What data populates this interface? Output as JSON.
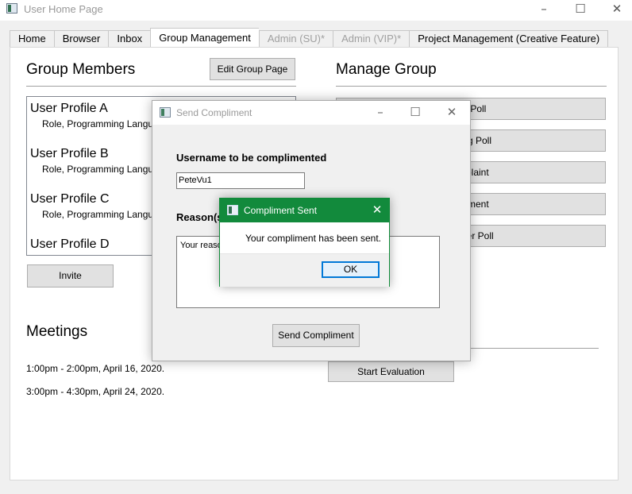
{
  "window": {
    "title": "User Home Page",
    "controls": {
      "minimize": "–",
      "maximize": "☐",
      "close": "✕"
    }
  },
  "tabs": [
    {
      "label": "Home",
      "state": "normal"
    },
    {
      "label": "Browser",
      "state": "normal"
    },
    {
      "label": "Inbox",
      "state": "normal"
    },
    {
      "label": "Group Management",
      "state": "active"
    },
    {
      "label": "Admin (SU)*",
      "state": "disabled"
    },
    {
      "label": "Admin (VIP)*",
      "state": "disabled"
    },
    {
      "label": "Project Management (Creative Feature)",
      "state": "normal"
    }
  ],
  "group_members": {
    "title": "Group Members",
    "edit_button": "Edit Group Page",
    "invite_button": "Invite",
    "members": [
      {
        "name": "User Profile A",
        "details": "Role, Programming Langu"
      },
      {
        "name": "User Profile B",
        "details": "Role, Programming Langu"
      },
      {
        "name": "User Profile C",
        "details": "Role, Programming Langu"
      },
      {
        "name": "User Profile D",
        "details": ""
      }
    ]
  },
  "manage_group": {
    "title": "Manage Group",
    "buttons": [
      "Up Poll",
      "osing Poll",
      "omplaint",
      "npliment",
      "ember Poll"
    ],
    "start_evaluation_button": "Start Evaluation"
  },
  "meetings": {
    "title": "Meetings",
    "items": [
      "1:00pm - 2:00pm, April 16, 2020.",
      "3:00pm - 4:30pm, April 24, 2020."
    ]
  },
  "send_compliment_dialog": {
    "title": "Send Compliment",
    "controls": {
      "minimize": "–",
      "maximize": "☐",
      "close": "✕"
    },
    "username_label": "Username to be complimented",
    "username_value": "PeteVu1",
    "reason_label": "Reason(s",
    "reason_value": "Your reaso",
    "send_button": "Send Compliment"
  },
  "compliment_sent_message": {
    "title": "Compliment Sent",
    "close": "✕",
    "text": "Your compliment has been sent.",
    "ok_button": "OK",
    "accent_color": "#128a3c"
  }
}
